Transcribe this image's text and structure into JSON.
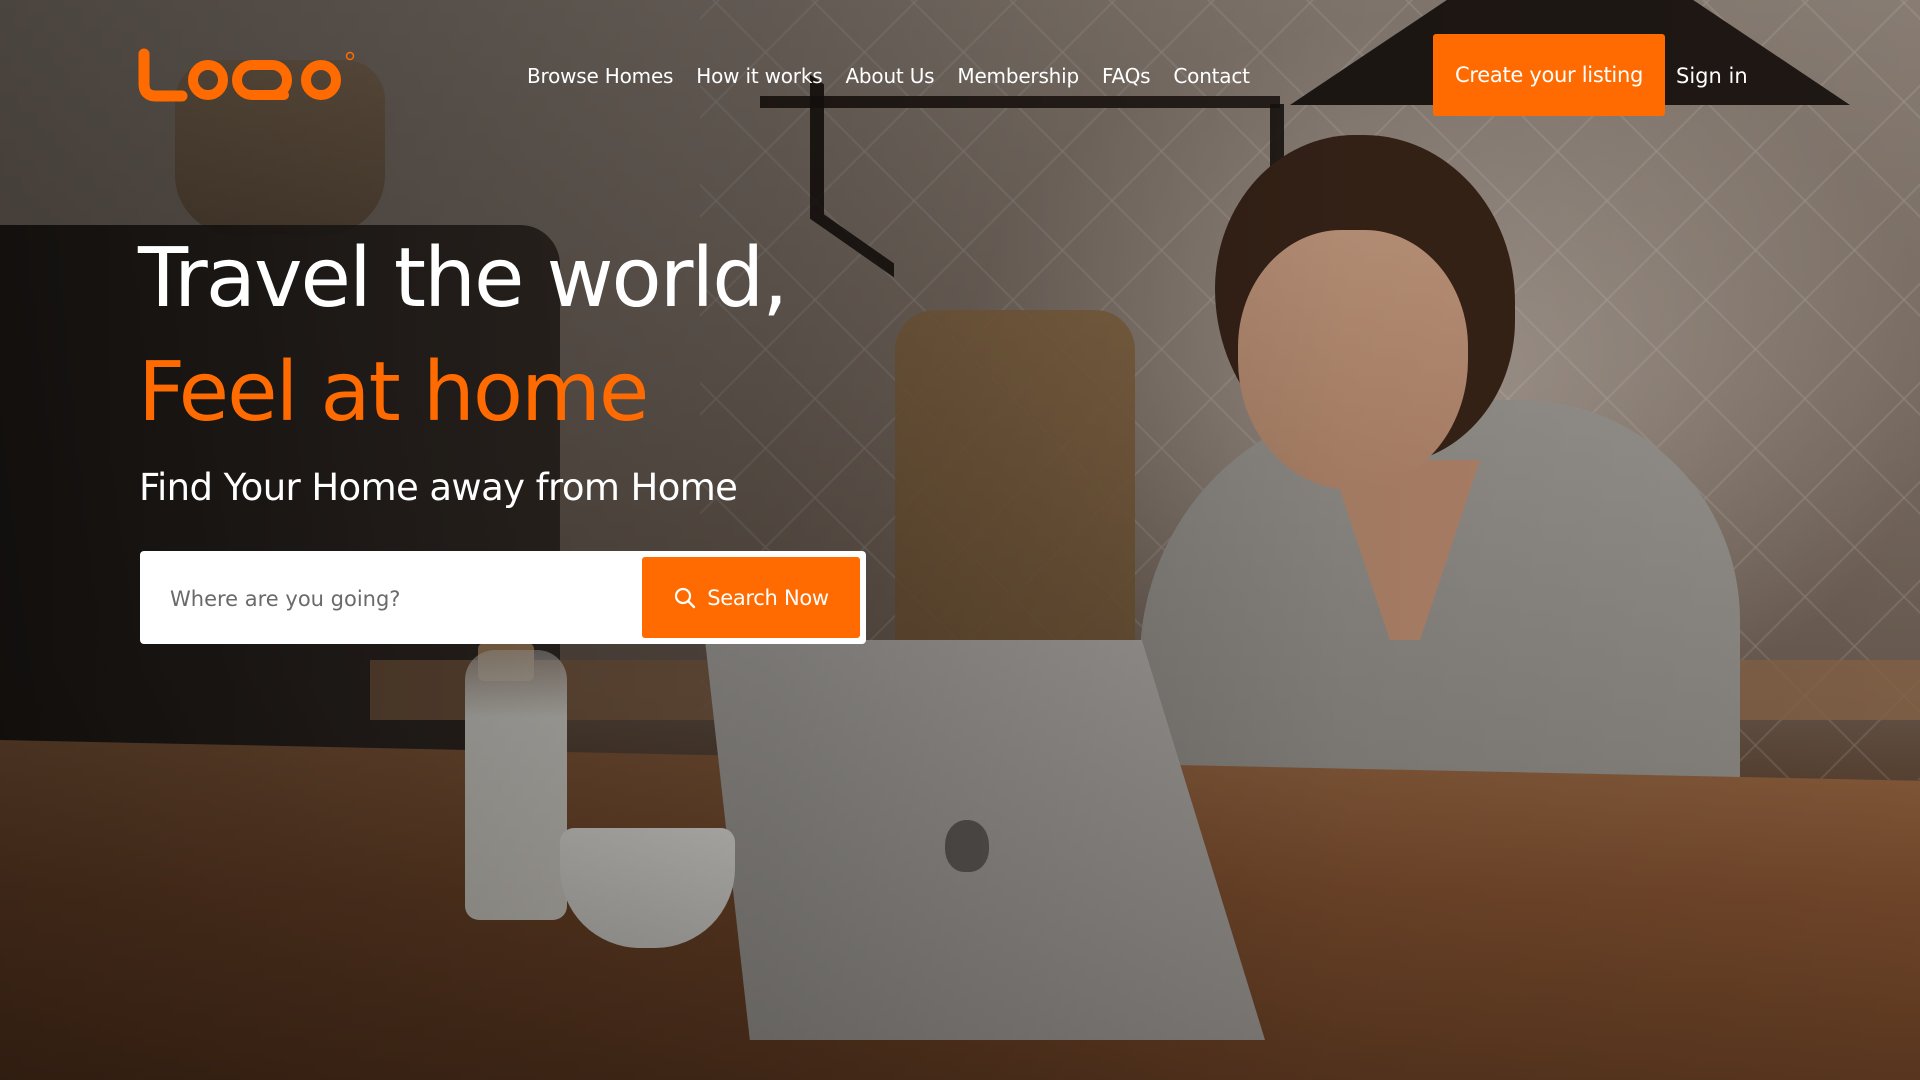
{
  "brand": {
    "logo_text": "LOGO",
    "accent_color": "#ff6b00"
  },
  "nav": {
    "items": [
      {
        "label": "Browse Homes"
      },
      {
        "label": "How it works"
      },
      {
        "label": "About Us"
      },
      {
        "label": "Membership"
      },
      {
        "label": "FAQs"
      },
      {
        "label": "Contact"
      }
    ],
    "cta_label": "Create your listing",
    "signin_label": "Sign in"
  },
  "hero": {
    "headline_line1": "Travel the world,",
    "headline_line2": "Feel at home",
    "subheadline": "Find Your Home away from Home"
  },
  "search": {
    "placeholder": "Where are you going?",
    "value": "",
    "button_label": "Search Now",
    "button_icon": "search-icon"
  }
}
